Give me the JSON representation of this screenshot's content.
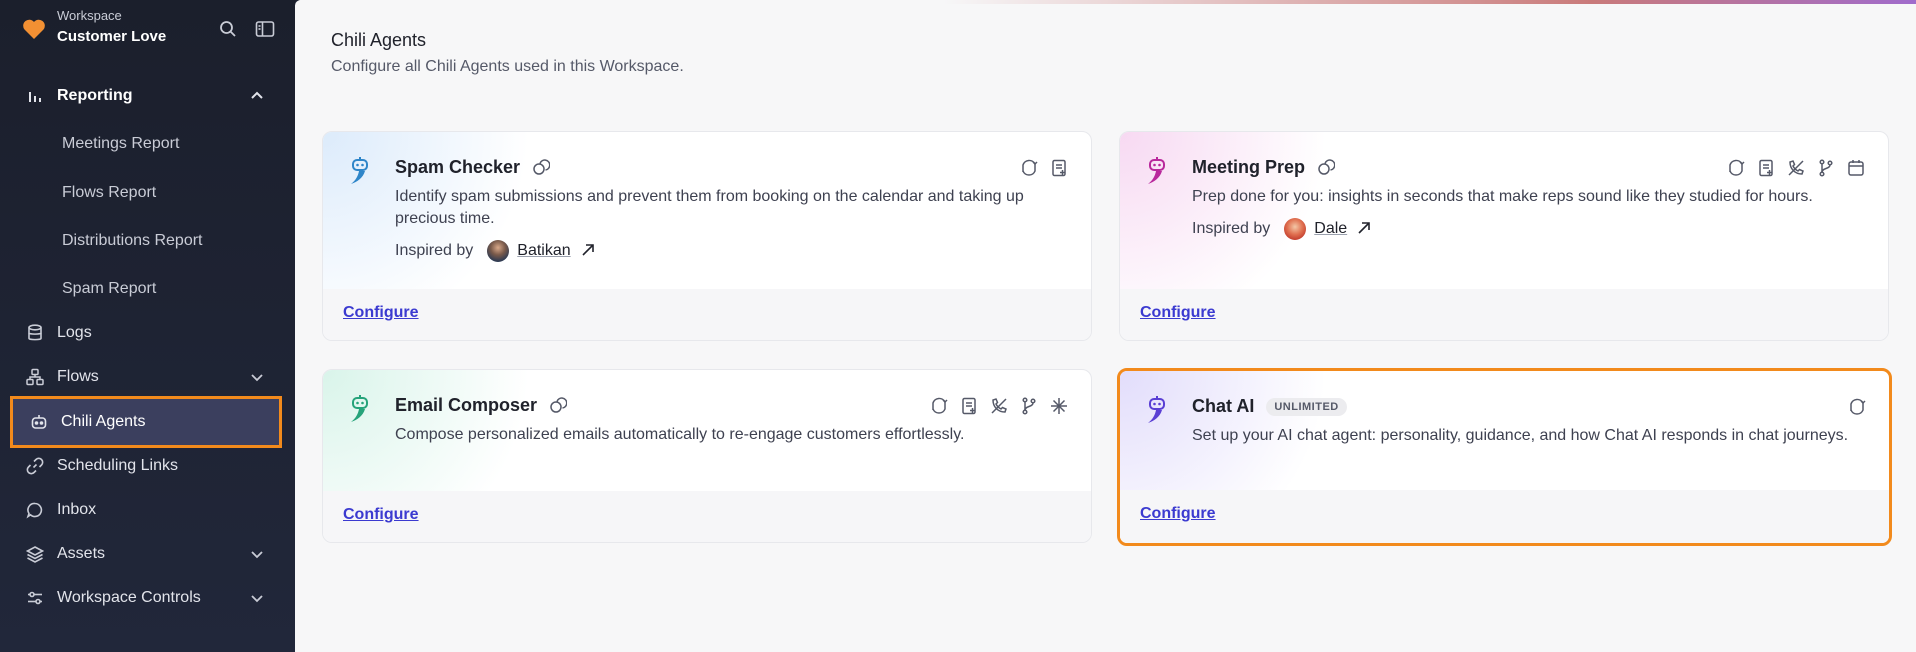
{
  "workspace": {
    "label": "Workspace",
    "name": "Customer Love"
  },
  "nav": {
    "reporting": "Reporting",
    "reporting_sub": [
      "Meetings Report",
      "Flows Report",
      "Distributions Report",
      "Spam Report"
    ],
    "logs": "Logs",
    "flows": "Flows",
    "chili_agents": "Chili Agents",
    "scheduling_links": "Scheduling Links",
    "inbox": "Inbox",
    "assets": "Assets",
    "workspace_controls": "Workspace Controls"
  },
  "page": {
    "title": "Chili Agents",
    "subtitle": "Configure all Chili Agents used in this Workspace."
  },
  "cards": [
    {
      "title": "Spam Checker",
      "description": "Identify spam submissions and prevent them from booking on the calendar and taking up precious time.",
      "inspired_label": "Inspired by",
      "inspired_by": "Batikan",
      "configure": "Configure",
      "tools": [
        "refresh-icon",
        "document-icon"
      ]
    },
    {
      "title": "Meeting Prep",
      "description": "Prep done for you: insights in seconds that make reps sound like they studied for hours.",
      "inspired_label": "Inspired by",
      "inspired_by": "Dale",
      "configure": "Configure",
      "tools": [
        "refresh-icon",
        "document-icon",
        "phone-off-icon",
        "branch-icon",
        "calendar-icon"
      ]
    },
    {
      "title": "Email Composer",
      "description": "Compose personalized emails automatically to re-engage customers effortlessly.",
      "configure": "Configure",
      "tools": [
        "refresh-icon",
        "document-icon",
        "phone-off-icon",
        "branch-icon",
        "sparkle-icon"
      ]
    },
    {
      "title": "Chat AI",
      "badge": "UNLIMITED",
      "description": "Set up your AI chat agent: personality, guidance, and how Chat AI responds in chat journeys.",
      "configure": "Configure",
      "tools": [
        "refresh-icon"
      ]
    }
  ],
  "colors": {
    "accent": "#3b3ad0",
    "highlight": "#f28a1c",
    "sidebar": "#1d2130"
  }
}
